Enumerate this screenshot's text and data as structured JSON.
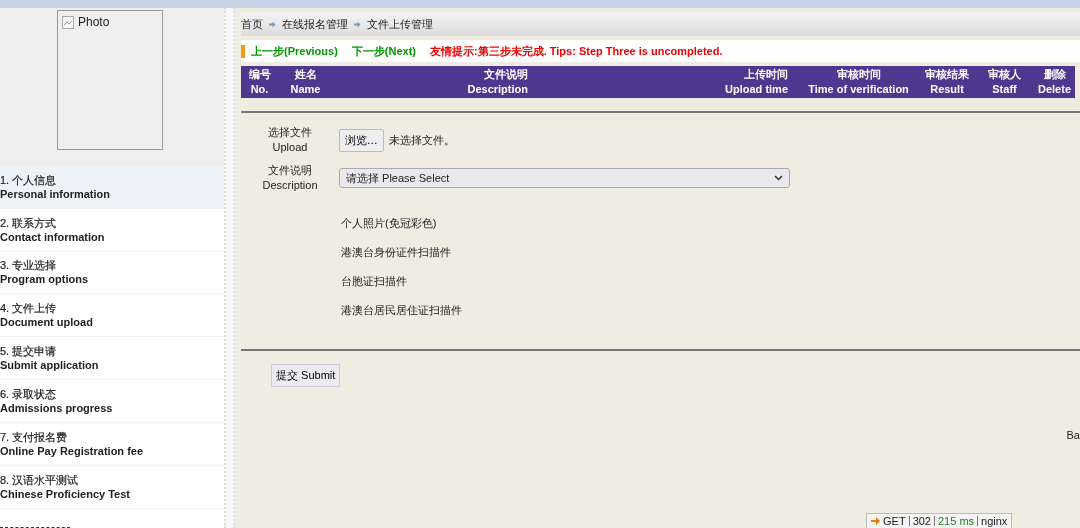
{
  "photo": {
    "alt": "Photo"
  },
  "sidebar": {
    "items": [
      {
        "label": "1. 个人信息",
        "label_en": "Personal information",
        "selected": true
      },
      {
        "label": "2. 联系方式",
        "label_en": "Contact information",
        "selected": false
      },
      {
        "label": "3. 专业选择",
        "label_en": "Program options",
        "selected": false
      },
      {
        "label": "4. 文件上传",
        "label_en": "Document upload",
        "selected": false
      },
      {
        "label": "5. 提交申请",
        "label_en": "Submit application",
        "selected": false
      },
      {
        "label": "6. 录取状态",
        "label_en": "Admissions progress",
        "selected": false
      },
      {
        "label": "7. 支付报名费",
        "label_en": "Online Pay Registration fee",
        "selected": false
      },
      {
        "label": "8. 汉语水平测试",
        "label_en": "Chinese Proficiency Test",
        "selected": false
      }
    ]
  },
  "breadcrumb": [
    "首页",
    "在线报名管理",
    "文件上传管理"
  ],
  "steps": {
    "previous": "上一步(Previous)",
    "next": "下一步(Next)",
    "tip": "友情提示:第三步未完成. Tips: Step Three is uncompleted."
  },
  "table": {
    "columns": [
      {
        "zh": "编号",
        "en": "No."
      },
      {
        "zh": "姓名",
        "en": "Name"
      },
      {
        "zh": "文件说明",
        "en": "Description"
      },
      {
        "zh": "上传时间",
        "en": "Upload time"
      },
      {
        "zh": "审核时间",
        "en": "Time of verification"
      },
      {
        "zh": "审核结果",
        "en": "Result"
      },
      {
        "zh": "审核人",
        "en": "Staff"
      },
      {
        "zh": "删除",
        "en": "Delete"
      }
    ]
  },
  "form": {
    "upload_label": "选择文件",
    "upload_label_en": "Upload",
    "browse_button": "浏览...",
    "file_status": "未选择文件。",
    "description_label": "文件说明",
    "description_label_en": "Description",
    "description_value": "请选择 Please Select"
  },
  "documents": [
    "个人照片(免冠彩色)",
    "港澳台身份证件扫描件",
    "台胞证扫描件",
    "港澳台居民居住证扫描件"
  ],
  "submit_button": "提交 Submit",
  "right_edge_text": "Ba",
  "debug_bar": {
    "method": "GET",
    "status": "302",
    "time": "215 ms",
    "server": "nginx"
  }
}
